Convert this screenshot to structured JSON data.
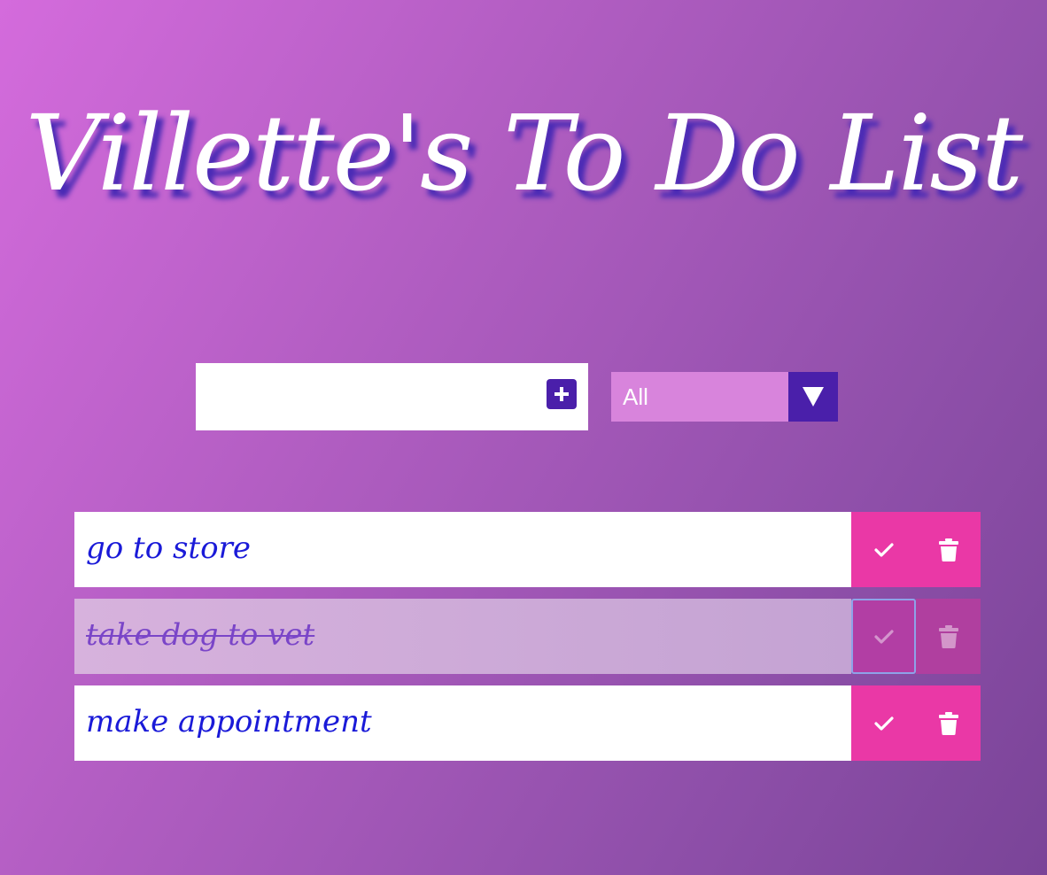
{
  "header": {
    "title": "Villette's To Do List"
  },
  "form": {
    "input_value": "",
    "input_placeholder": "",
    "add_icon": "plus-square-icon",
    "filter_selected": "All",
    "filter_arrow_icon": "triangle-down-icon"
  },
  "todos": [
    {
      "text": "go to store",
      "completed": false
    },
    {
      "text": "take dog to vet",
      "completed": true
    },
    {
      "text": "make appointment",
      "completed": false
    }
  ],
  "icons": {
    "complete": "check-icon",
    "delete": "trash-icon"
  },
  "colors": {
    "accent_purple": "#4a1faa",
    "button_pink": "#ea38a6",
    "filter_bg": "#d884dc",
    "todo_text": "#1a1ad8",
    "title_shadow": "#4a2bb5"
  }
}
